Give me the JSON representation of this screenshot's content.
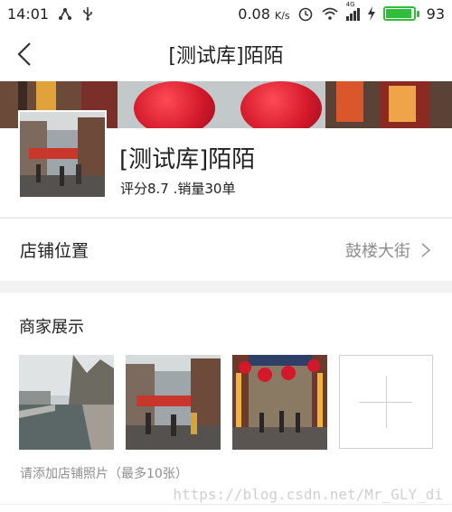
{
  "status_bar": {
    "time": "14:01",
    "network_speed": "0.08",
    "network_unit": "K/s",
    "signal_label": "4G",
    "battery_level": "93",
    "battery_fraction": 0.93,
    "battery_color": "#2fbf3a"
  },
  "header": {
    "title": "[测试库]陌陌"
  },
  "shop": {
    "name": "[测试库]陌陌",
    "meta": "评分8.7 .销量30单"
  },
  "location": {
    "label": "店铺位置",
    "value": "鼓楼大街"
  },
  "showcase": {
    "title": "商家展示",
    "hint": "请添加店铺照片（最多10张）",
    "watermark": "https://blog.csdn.net/Mr_GLY_di"
  },
  "colors": {
    "accent_red": "#d2182a",
    "muted_text": "#8d8d8d",
    "battery_green": "#2fbf3a"
  }
}
